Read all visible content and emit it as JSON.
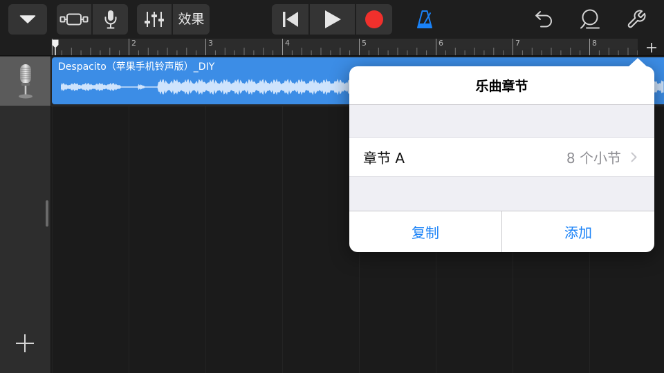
{
  "toolbar": {
    "effects_label": "效果"
  },
  "transport": {
    "metronome_enabled": true
  },
  "ruler": {
    "bar_numbers": [
      "2",
      "3",
      "4",
      "5",
      "6",
      "7",
      "8"
    ]
  },
  "tracks": [
    {
      "region_name": "Despacito（苹果手机铃声版）_DIY",
      "instrument_icon": "microphone-icon"
    }
  ],
  "popover": {
    "title": "乐曲章节",
    "sections": [
      {
        "name": "章节 A",
        "length": "8 个小节"
      }
    ],
    "duplicate_label": "复制",
    "add_label": "添加"
  },
  "icons": {
    "menu": "triangle-down-icon",
    "tracks_view": "tracks-view-icon",
    "mic": "microphone-icon",
    "mixer": "mixer-sliders-icon",
    "go_to_start": "go-to-start-icon",
    "play": "play-icon",
    "record": "record-icon",
    "metronome": "metronome-icon",
    "undo": "undo-icon",
    "loops": "loop-icon",
    "settings": "wrench-icon",
    "add_section": "plus-icon",
    "add_track": "plus-icon",
    "section_disclosure": "chevron-right-icon"
  },
  "colors": {
    "accent": "#1a82f7",
    "region": "#3c8de6",
    "record": "#f0302c",
    "inactive_icon": "#d0d0d0"
  }
}
